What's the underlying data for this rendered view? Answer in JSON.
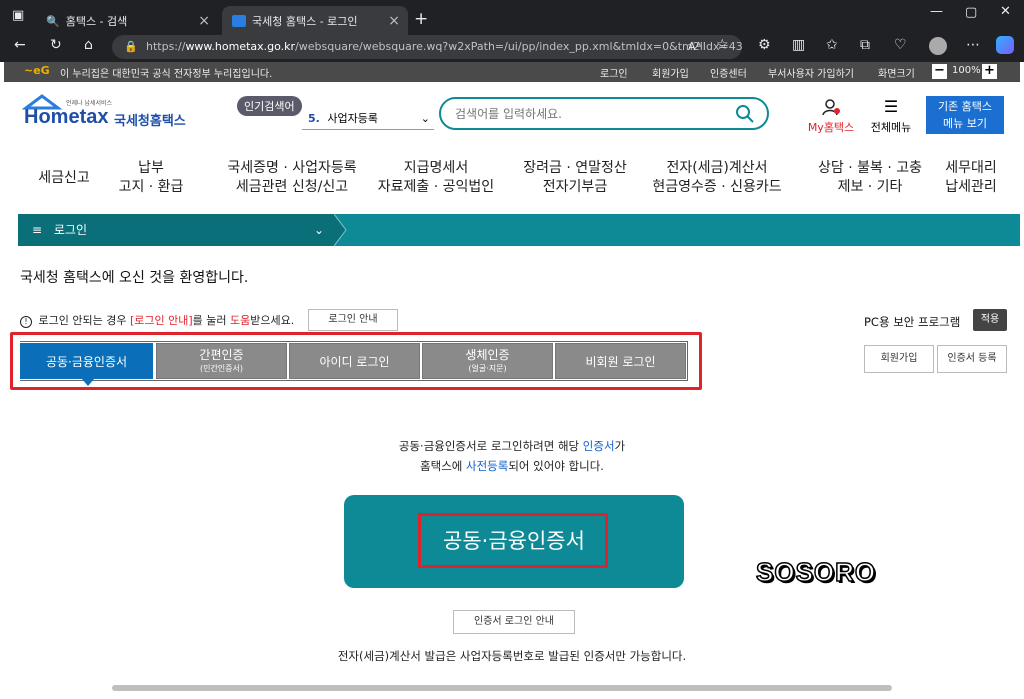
{
  "browser": {
    "tabs": [
      {
        "title": "홈택스 - 검색"
      },
      {
        "title": "국세청 홈택스 - 로그인"
      }
    ],
    "url_prefix": "https://",
    "url_host": "www.hometax.go.kr",
    "url_path": "/websquare/websquare.wq?w2xPath=/ui/pp/index_pp.xml&tmIdx=0&tm2lIdx=43..."
  },
  "topbar": {
    "notice": "이 누리집은 대한민국 공식 전자정부 누리집입니다.",
    "links": [
      "로그인",
      "회원가입",
      "인증센터",
      "부서사용자 가입하기",
      "화면크기"
    ],
    "zoom": "100%"
  },
  "header": {
    "logo_small": "언제나 납세서비스",
    "logo_main": "Hometax",
    "logo_text": "국세청홈택스",
    "popular_label": "인기검색어",
    "popular_num": "5.",
    "popular_term": "사업자등록",
    "search_placeholder": "검색어를 입력하세요.",
    "my_label": "My홈택스",
    "menu_label": "전체메뉴",
    "legacy_line1": "기존 홈택스",
    "legacy_line2": "메뉴 보기"
  },
  "gnb": [
    {
      "l1": "세금신고",
      "l2": ""
    },
    {
      "l1": "납부",
      "l2": "고지 · 환급"
    },
    {
      "l1": "국세증명 · 사업자등록",
      "l2": "세금관련 신청/신고"
    },
    {
      "l1": "지급명세서",
      "l2": "자료제출 · 공익법인"
    },
    {
      "l1": "장려금 · 연말정산",
      "l2": "전자기부금"
    },
    {
      "l1": "전자(세금)계산서",
      "l2": "현금영수증 · 신용카드"
    },
    {
      "l1": "상담 · 불복 · 고충",
      "l2": "제보 · 기타"
    },
    {
      "l1": "세무대리",
      "l2": "납세관리"
    }
  ],
  "breadcrumb": {
    "menu": "로그인"
  },
  "welcome": "국세청 홈택스에 오신 것을 환영합니다.",
  "help": {
    "prefix": "로그인 안되는 경우 ",
    "link": "[로그인 안내]",
    "middle": "를 눌러 ",
    "em": "도움",
    "suffix": "받으세요.",
    "button": "로그인 안내"
  },
  "security": {
    "label": "PC용 보안 프로그램",
    "button": "적용"
  },
  "auth_tabs": [
    {
      "label": "공동·금융인증서",
      "sub": ""
    },
    {
      "label": "간편인증",
      "sub": "(민간인증서)"
    },
    {
      "label": "아이디 로그인",
      "sub": ""
    },
    {
      "label": "생체인증",
      "sub": "(얼굴·지문)"
    },
    {
      "label": "비회원 로그인",
      "sub": ""
    }
  ],
  "side_buttons": {
    "join": "회원가입",
    "cert_reg": "인증서 등록"
  },
  "instruction": {
    "p1": "공동·금융인증서로 로그인하려면 해당 ",
    "k1": "인증서",
    "p2": "가",
    "p3": "홈택스에 ",
    "k2": "사전등록",
    "p4": "되어 있어야 합니다."
  },
  "main_button": "공동·금융인증서",
  "watermark": "SOSORO",
  "cert_guide_button": "인증서 로그인 안내",
  "footer_note": "전자(세금)계산서 발급은 사업자등록번호로 발급된 인증서만 가능합니다.",
  "colors": {
    "accent": "#0d8a96",
    "active_tab": "#0a6fb8",
    "highlight": "#e0222a",
    "keyword": "#1560c8"
  }
}
